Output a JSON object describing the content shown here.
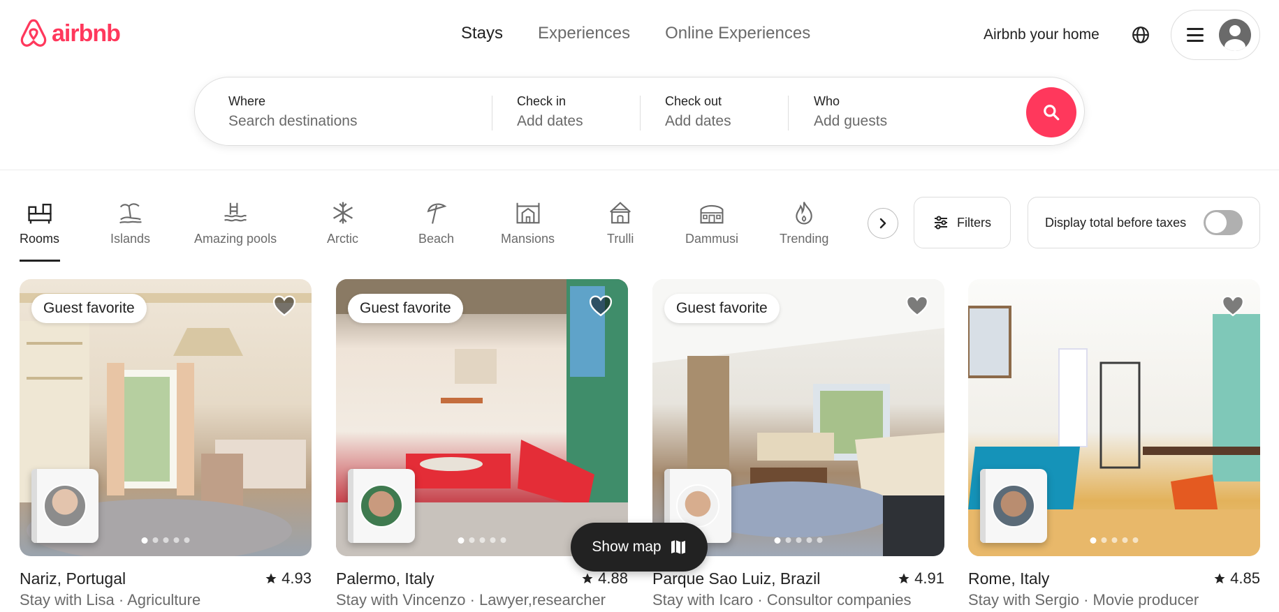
{
  "brand": {
    "name": "airbnb",
    "color": "#ff385c"
  },
  "nav": {
    "tabs": [
      {
        "label": "Stays",
        "active": true
      },
      {
        "label": "Experiences",
        "active": false
      },
      {
        "label": "Online Experiences",
        "active": false
      }
    ],
    "host_link": "Airbnb your home",
    "globe_icon": "globe-icon",
    "menu_icon": "hamburger-icon",
    "avatar_icon": "user-avatar-icon"
  },
  "search": {
    "where": {
      "label": "Where",
      "placeholder": "Search destinations"
    },
    "checkin": {
      "label": "Check in",
      "placeholder": "Add dates"
    },
    "checkout": {
      "label": "Check out",
      "placeholder": "Add dates"
    },
    "who": {
      "label": "Who",
      "placeholder": "Add guests"
    },
    "button_icon": "search-icon"
  },
  "categories": [
    {
      "label": "Rooms",
      "icon": "bed-icon",
      "active": true
    },
    {
      "label": "Islands",
      "icon": "island-icon",
      "active": false
    },
    {
      "label": "Amazing pools",
      "icon": "pool-icon",
      "active": false
    },
    {
      "label": "Arctic",
      "icon": "snowflake-icon",
      "active": false
    },
    {
      "label": "Beach",
      "icon": "umbrella-icon",
      "active": false
    },
    {
      "label": "Mansions",
      "icon": "mansion-icon",
      "active": false
    },
    {
      "label": "Trulli",
      "icon": "trulli-icon",
      "active": false
    },
    {
      "label": "Dammusi",
      "icon": "dammusi-icon",
      "active": false
    },
    {
      "label": "Trending",
      "icon": "flame-icon",
      "active": false
    }
  ],
  "filters": {
    "label": "Filters",
    "icon": "sliders-icon"
  },
  "taxes": {
    "label": "Display total before taxes",
    "enabled": false
  },
  "listings": [
    {
      "badge": "Guest favorite",
      "title": "Nariz, Portugal",
      "rating": "4.93",
      "subtitle": "Stay with Lisa · Agriculture",
      "palette": [
        "#e9dcc8",
        "#b79a78",
        "#8e9db0"
      ]
    },
    {
      "badge": "Guest favorite",
      "title": "Palermo, Italy",
      "rating": "4.88",
      "subtitle": "Stay with Vincenzo · Lawyer,researcher",
      "palette": [
        "#f1e7de",
        "#e8343f",
        "#7fae8c"
      ]
    },
    {
      "badge": "Guest favorite",
      "title": "Parque Sao Luiz, Brazil",
      "rating": "4.91",
      "subtitle": "Stay with Icaro · Consultor companies",
      "palette": [
        "#ecebe7",
        "#9c7f62",
        "#b4c0cf"
      ]
    },
    {
      "badge": "",
      "title": "Rome, Italy",
      "rating": "4.85",
      "subtitle": "Stay with Sergio · Movie producer",
      "palette": [
        "#f4f3ef",
        "#1f8fb8",
        "#e9b55a"
      ]
    }
  ],
  "show_map": {
    "label": "Show map",
    "icon": "map-icon"
  }
}
